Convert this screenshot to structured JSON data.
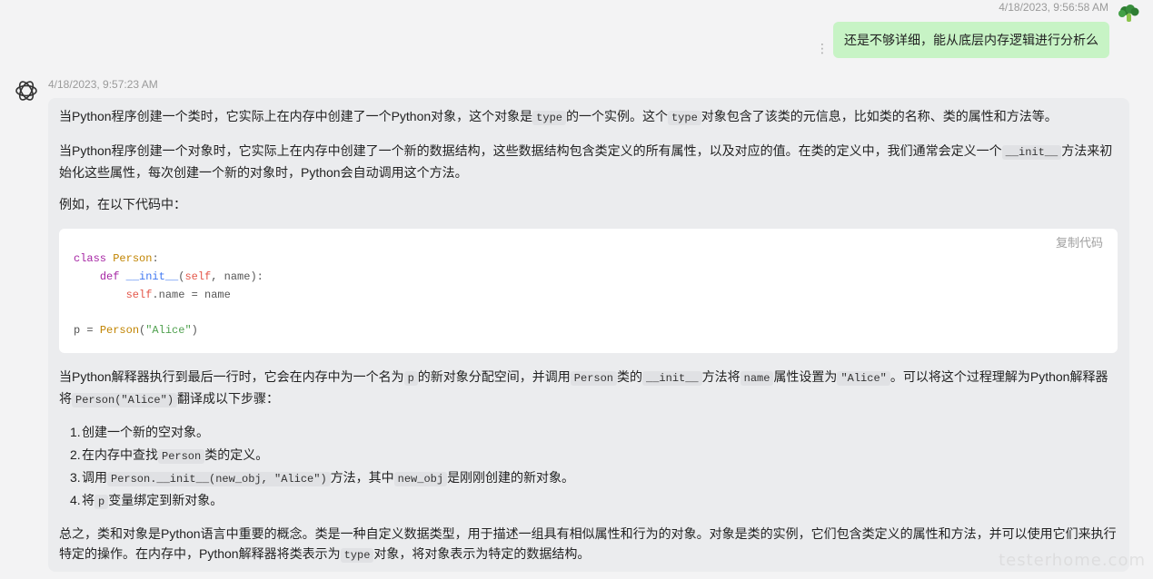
{
  "user_message": {
    "timestamp": "4/18/2023, 9:56:58 AM",
    "text": "还是不够详细，能从底层内存逻辑进行分析么",
    "more_icon": "more-vertical-icon",
    "avatar_icon": "broccoli-avatar-icon",
    "bubble_color": "#c7f3c5"
  },
  "bot_message": {
    "timestamp": "4/18/2023, 9:57:23 AM",
    "avatar_icon": "openai-logo-icon",
    "p1": {
      "a": "当Python程序创建一个类时，它实际上在内存中创建了一个Python对象，这个对象是",
      "c1": "type",
      "b": "的一个实例。这个",
      "c2": "type",
      "d": "对象包含了该类的元信息，比如类的名称、类的属性和方法等。"
    },
    "p2": {
      "a": "当Python程序创建一个对象时，它实际上在内存中创建了一个新的数据结构，这些数据结构包含类定义的所有属性，以及对应的值。在类的定义中，我们通常会定义一个",
      "c1": "__init__",
      "b": "方法来初始化这些属性，每次创建一个新的对象时，Python会自动调用这个方法。"
    },
    "p3": "例如，在以下代码中：",
    "code": {
      "copy_label": "复制代码",
      "line1": {
        "kw": "class",
        "name": "Person",
        "end": ":"
      },
      "line2": {
        "kw": "def",
        "name": "__init__",
        "open": "(",
        "self": "self",
        "rest": ", name):"
      },
      "line3": {
        "self": "self",
        "rest": ".name = name"
      },
      "line4": {
        "a": "p = ",
        "name": "Person",
        "open": "(",
        "str": "\"Alice\"",
        "close": ")"
      }
    },
    "p4": {
      "a": "当Python解释器执行到最后一行时，它会在内存中为一个名为",
      "c1": "p",
      "b": "的新对象分配空间，并调用",
      "c2": "Person",
      "c": "类的",
      "c3": "__init__",
      "d": "方法将",
      "c4": "name",
      "e": "属性设置为",
      "c5": "\"Alice\"",
      "f": "。可以将这个过程理解为Python解释器将",
      "c6": "Person(\"Alice\")",
      "g": "翻译成以下步骤："
    },
    "steps": [
      {
        "num": "1.",
        "a": "创建一个新的空对象。"
      },
      {
        "num": "2.",
        "a": "在内存中查找",
        "c1": "Person",
        "b": "类的定义。"
      },
      {
        "num": "3.",
        "a": "调用",
        "c1": "Person.__init__(new_obj, \"Alice\")",
        "b": "方法，其中",
        "c2": "new_obj",
        "c": "是刚刚创建的新对象。"
      },
      {
        "num": "4.",
        "a": "将",
        "c1": "p",
        "b": "变量绑定到新对象。"
      }
    ],
    "p5": {
      "a": "总之，类和对象是Python语言中重要的概念。类是一种自定义数据类型，用于描述一组具有相似属性和行为的对象。对象是类的实例，它们包含类定义的属性和方法，并可以使用它们来执行特定的操作。在内存中，Python解释器将类表示为",
      "c1": "type",
      "b": "对象，将对象表示为特定的数据结构。"
    }
  },
  "watermark": "testerhome.com"
}
